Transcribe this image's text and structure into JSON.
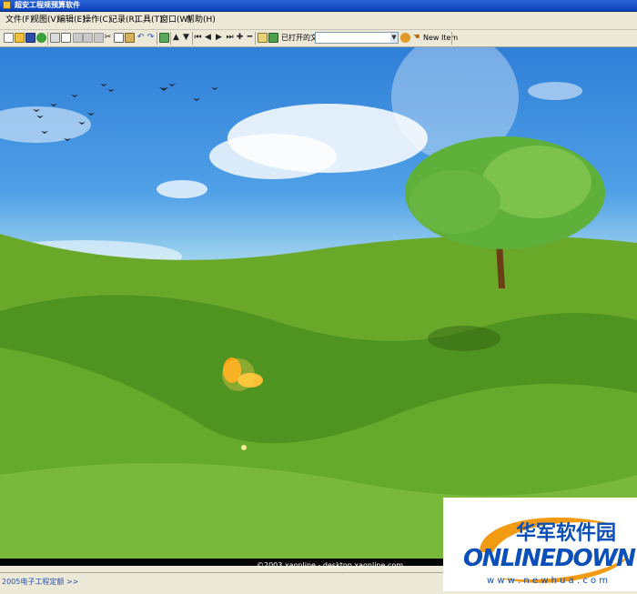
{
  "window": {
    "title": "超安工程规预算软件"
  },
  "menu": [
    "文件(F)",
    "视图(V)",
    "编辑(E)",
    "操作(C)",
    "记录(R)",
    "工具(T)",
    "窗口(W)",
    "帮助(H)"
  ],
  "toolbar": {
    "opened_label": "已打开的文件",
    "file_select_value": "",
    "new_item_label": "New Item",
    "icons": [
      "new-icon",
      "open-icon",
      "save-icon",
      "globe-icon",
      "print-icon",
      "preview-icon",
      "copy-icon",
      "cut-icon",
      "paste-icon",
      "undo-icon",
      "redo-icon",
      "refresh-icon",
      "up-icon",
      "down-icon",
      "first-icon",
      "prev-icon",
      "next-icon",
      "last-icon",
      "plus-icon",
      "minus-icon",
      "grid-icon",
      "chart-icon"
    ]
  },
  "desktop": {
    "credit": "©2003 xaonline  -  desktop.xaonline.com"
  },
  "statusbar": {
    "text": "2005电子工程定额 >>"
  },
  "watermark": {
    "cn_text": "华军软件园",
    "brand": "ONLINEDOWN",
    "url": "w w w . n e w h u a . c o m"
  },
  "colors": {
    "title_bar": "#0a3fb8",
    "brand_blue": "#0b4fb8",
    "brand_orange": "#f29a12"
  }
}
